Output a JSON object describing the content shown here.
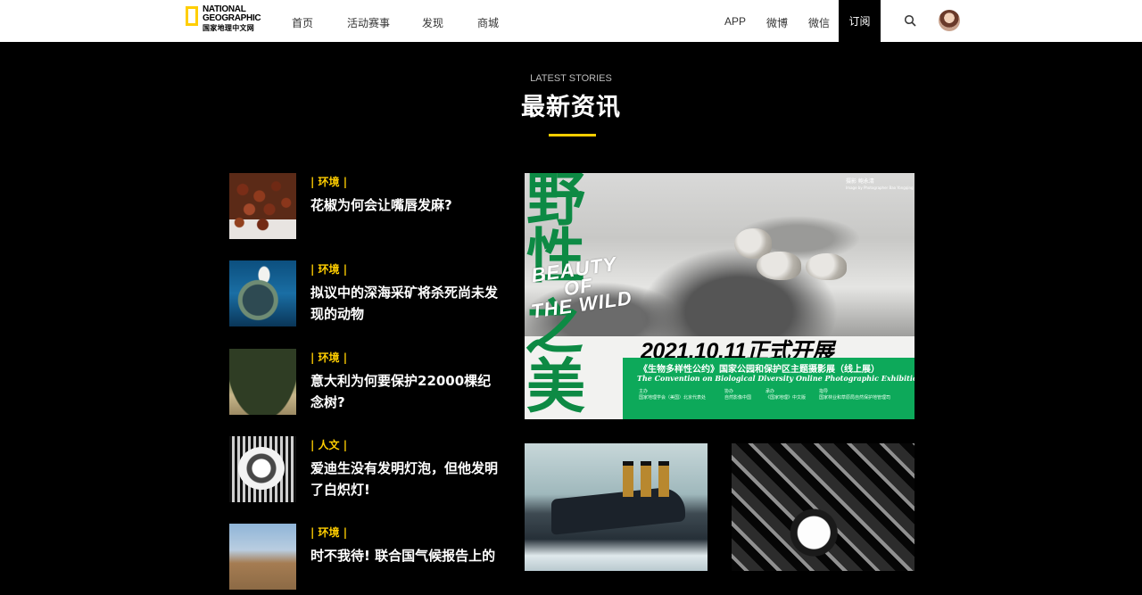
{
  "header": {
    "logo": {
      "line1": "NATIONAL",
      "line2": "GEOGRAPHIC",
      "cn": "国家地理中文网"
    },
    "nav_left": [
      "首页",
      "活动赛事",
      "发现",
      "商城"
    ],
    "nav_right": [
      "APP",
      "微博",
      "微信"
    ],
    "subscribe_label": "订阅",
    "search_icon": "search-icon",
    "accent_color": "#ffce00"
  },
  "section": {
    "title_en": "LATEST STORIES",
    "title_cn": "最新资讯"
  },
  "stories": [
    {
      "tag": "| 环境 |",
      "headline": "花椒为何会让嘴唇发麻?"
    },
    {
      "tag": "| 环境 |",
      "headline": "拟议中的深海采矿将杀死尚未发现的动物"
    },
    {
      "tag": "| 环境 |",
      "headline": "意大利为何要保护22000棵纪念树?"
    },
    {
      "tag": "| 人文 |",
      "headline": "爱迪生没有发明灯泡，但他发明了白炽灯!"
    },
    {
      "tag": "| 环境 |",
      "headline": "时不我待! 联合国气候报告上的"
    }
  ],
  "feature": {
    "cn_char_1": "野",
    "cn_char_2": "性",
    "cn_char_3": "之",
    "cn_char_4": "美",
    "beauty_en_1": "BEAUTY",
    "beauty_en_2": "OF",
    "beauty_en_3": "THE WILD",
    "photo_credit": "摄影 鲍永清",
    "photo_credit_en": "Image by Photographer Bao Yongqing",
    "date": "2021.10.11正式开展",
    "band_cn": "《生物多样性公约》国家公园和保护区主题摄影展（线上展）",
    "band_en": "The Convention on Biological Diversity Online Photographic Exhibition",
    "organizers": [
      {
        "role": "主办",
        "name": "国家地理学会（美国）北京代表处"
      },
      {
        "role": "协办",
        "name": "自然影像中国"
      },
      {
        "role": "承办",
        "name": "《国家地理》中文版"
      },
      {
        "role": "指导",
        "name": "国家林业和草原局自然保护地管理司"
      }
    ],
    "brand_green": "#0da95a"
  }
}
